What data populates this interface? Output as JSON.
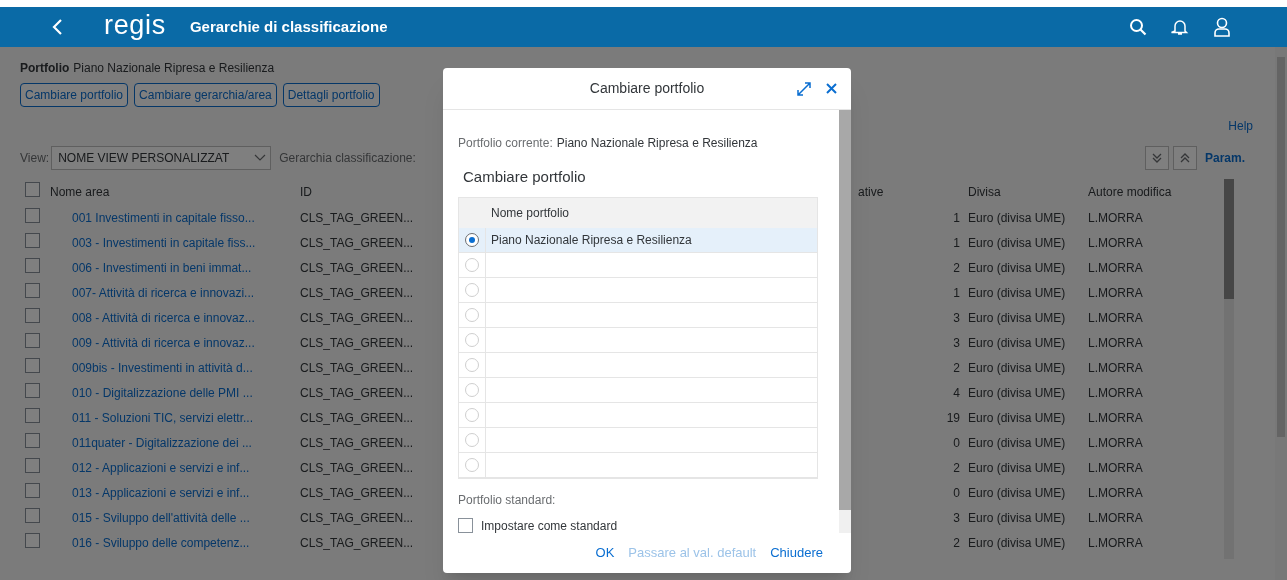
{
  "shell": {
    "logo": "regis",
    "title": "Gerarchie di classificazione"
  },
  "portfolio": {
    "label": "Portfolio",
    "value": "Piano Nazionale Ripresa e Resilienza"
  },
  "actions": [
    "Cambiare portfolio",
    "Cambiare gerarchia/area",
    "Dettagli portfolio"
  ],
  "help_link": "Help",
  "toolbar": {
    "view_label": "View:",
    "view_value": "NOME VIEW PERSONALIZZAT",
    "hierarchy_label": "Gerarchia classificazione:",
    "param_link": "Param."
  },
  "table": {
    "select_all_checked": false,
    "columns": [
      "Nome area",
      "ID",
      "ative",
      "Divisa",
      "Autore modifica"
    ],
    "rows": [
      {
        "checked": false,
        "cells": [
          "001 Investimenti in capitale fisso...",
          "CLS_TAG_GREEN...",
          "1",
          "Euro (divisa UME)",
          "L.MORRA"
        ]
      },
      {
        "checked": false,
        "cells": [
          "003 - Investimenti in capitale fiss...",
          "CLS_TAG_GREEN...",
          "1",
          "Euro (divisa UME)",
          "L.MORRA"
        ]
      },
      {
        "checked": false,
        "cells": [
          "006 - Investimenti in beni immat...",
          "CLS_TAG_GREEN...",
          "2",
          "Euro (divisa UME)",
          "L.MORRA"
        ]
      },
      {
        "checked": false,
        "cells": [
          "007- Attività di ricerca e innovazi...",
          "CLS_TAG_GREEN...",
          "1",
          "Euro (divisa UME)",
          "L.MORRA"
        ]
      },
      {
        "checked": false,
        "cells": [
          "008 - Attività di ricerca e innovaz...",
          "CLS_TAG_GREEN...",
          "3",
          "Euro (divisa UME)",
          "L.MORRA"
        ]
      },
      {
        "checked": false,
        "cells": [
          "009 - Attività di ricerca e innovaz...",
          "CLS_TAG_GREEN...",
          "3",
          "Euro (divisa UME)",
          "L.MORRA"
        ]
      },
      {
        "checked": false,
        "cells": [
          "009bis - Investimenti in attività d...",
          "CLS_TAG_GREEN...",
          "2",
          "Euro (divisa UME)",
          "L.MORRA"
        ]
      },
      {
        "checked": false,
        "cells": [
          "010 - Digitalizzazione delle PMI ...",
          "CLS_TAG_GREEN...",
          "4",
          "Euro (divisa UME)",
          "L.MORRA"
        ]
      },
      {
        "checked": false,
        "cells": [
          "011 - Soluzioni TIC, servizi elettr...",
          "CLS_TAG_GREEN...",
          "19",
          "Euro (divisa UME)",
          "L.MORRA"
        ]
      },
      {
        "checked": false,
        "cells": [
          "011quater - Digitalizzazione dei ...",
          "CLS_TAG_GREEN...",
          "0",
          "Euro (divisa UME)",
          "L.MORRA"
        ]
      },
      {
        "checked": false,
        "cells": [
          "012 - Applicazioni e servizi e inf...",
          "CLS_TAG_GREEN...",
          "2",
          "Euro (divisa UME)",
          "L.MORRA"
        ]
      },
      {
        "checked": false,
        "cells": [
          "013 - Applicazioni e servizi e inf...",
          "CLS_TAG_GREEN...",
          "0",
          "Euro (divisa UME)",
          "L.MORRA"
        ]
      },
      {
        "checked": false,
        "cells": [
          "015 - Sviluppo dell'attività delle ...",
          "CLS_TAG_GREEN...",
          "3",
          "Euro (divisa UME)",
          "L.MORRA"
        ]
      },
      {
        "checked": false,
        "cells": [
          "016 - Sviluppo delle competenz...",
          "CLS_TAG_GREEN...",
          "2",
          "Euro (divisa UME)",
          "L.MORRA"
        ]
      }
    ]
  },
  "dialog": {
    "title": "Cambiare portfolio",
    "current_label": "Portfolio corrente:",
    "current_value": "Piano Nazionale Ripresa e Resilienza",
    "section_title": "Cambiare portfolio",
    "list_header": "Nome portfolio",
    "portfolios": [
      {
        "name": "Piano Nazionale Ripresa e Resilienza",
        "selected": true
      },
      {
        "selected": false
      },
      {
        "selected": false
      },
      {
        "selected": false
      },
      {
        "selected": false
      },
      {
        "selected": false
      },
      {
        "selected": false
      },
      {
        "selected": false
      },
      {
        "selected": false
      },
      {
        "selected": false
      }
    ],
    "standard_label": "Portfolio standard:",
    "standard_checkbox": {
      "label": "Impostare come standard",
      "checked": false
    },
    "buttons": [
      {
        "label": "OK",
        "disabled": false
      },
      {
        "label": "Passare al val. default",
        "disabled": true
      },
      {
        "label": "Chiudere",
        "disabled": false
      }
    ]
  }
}
